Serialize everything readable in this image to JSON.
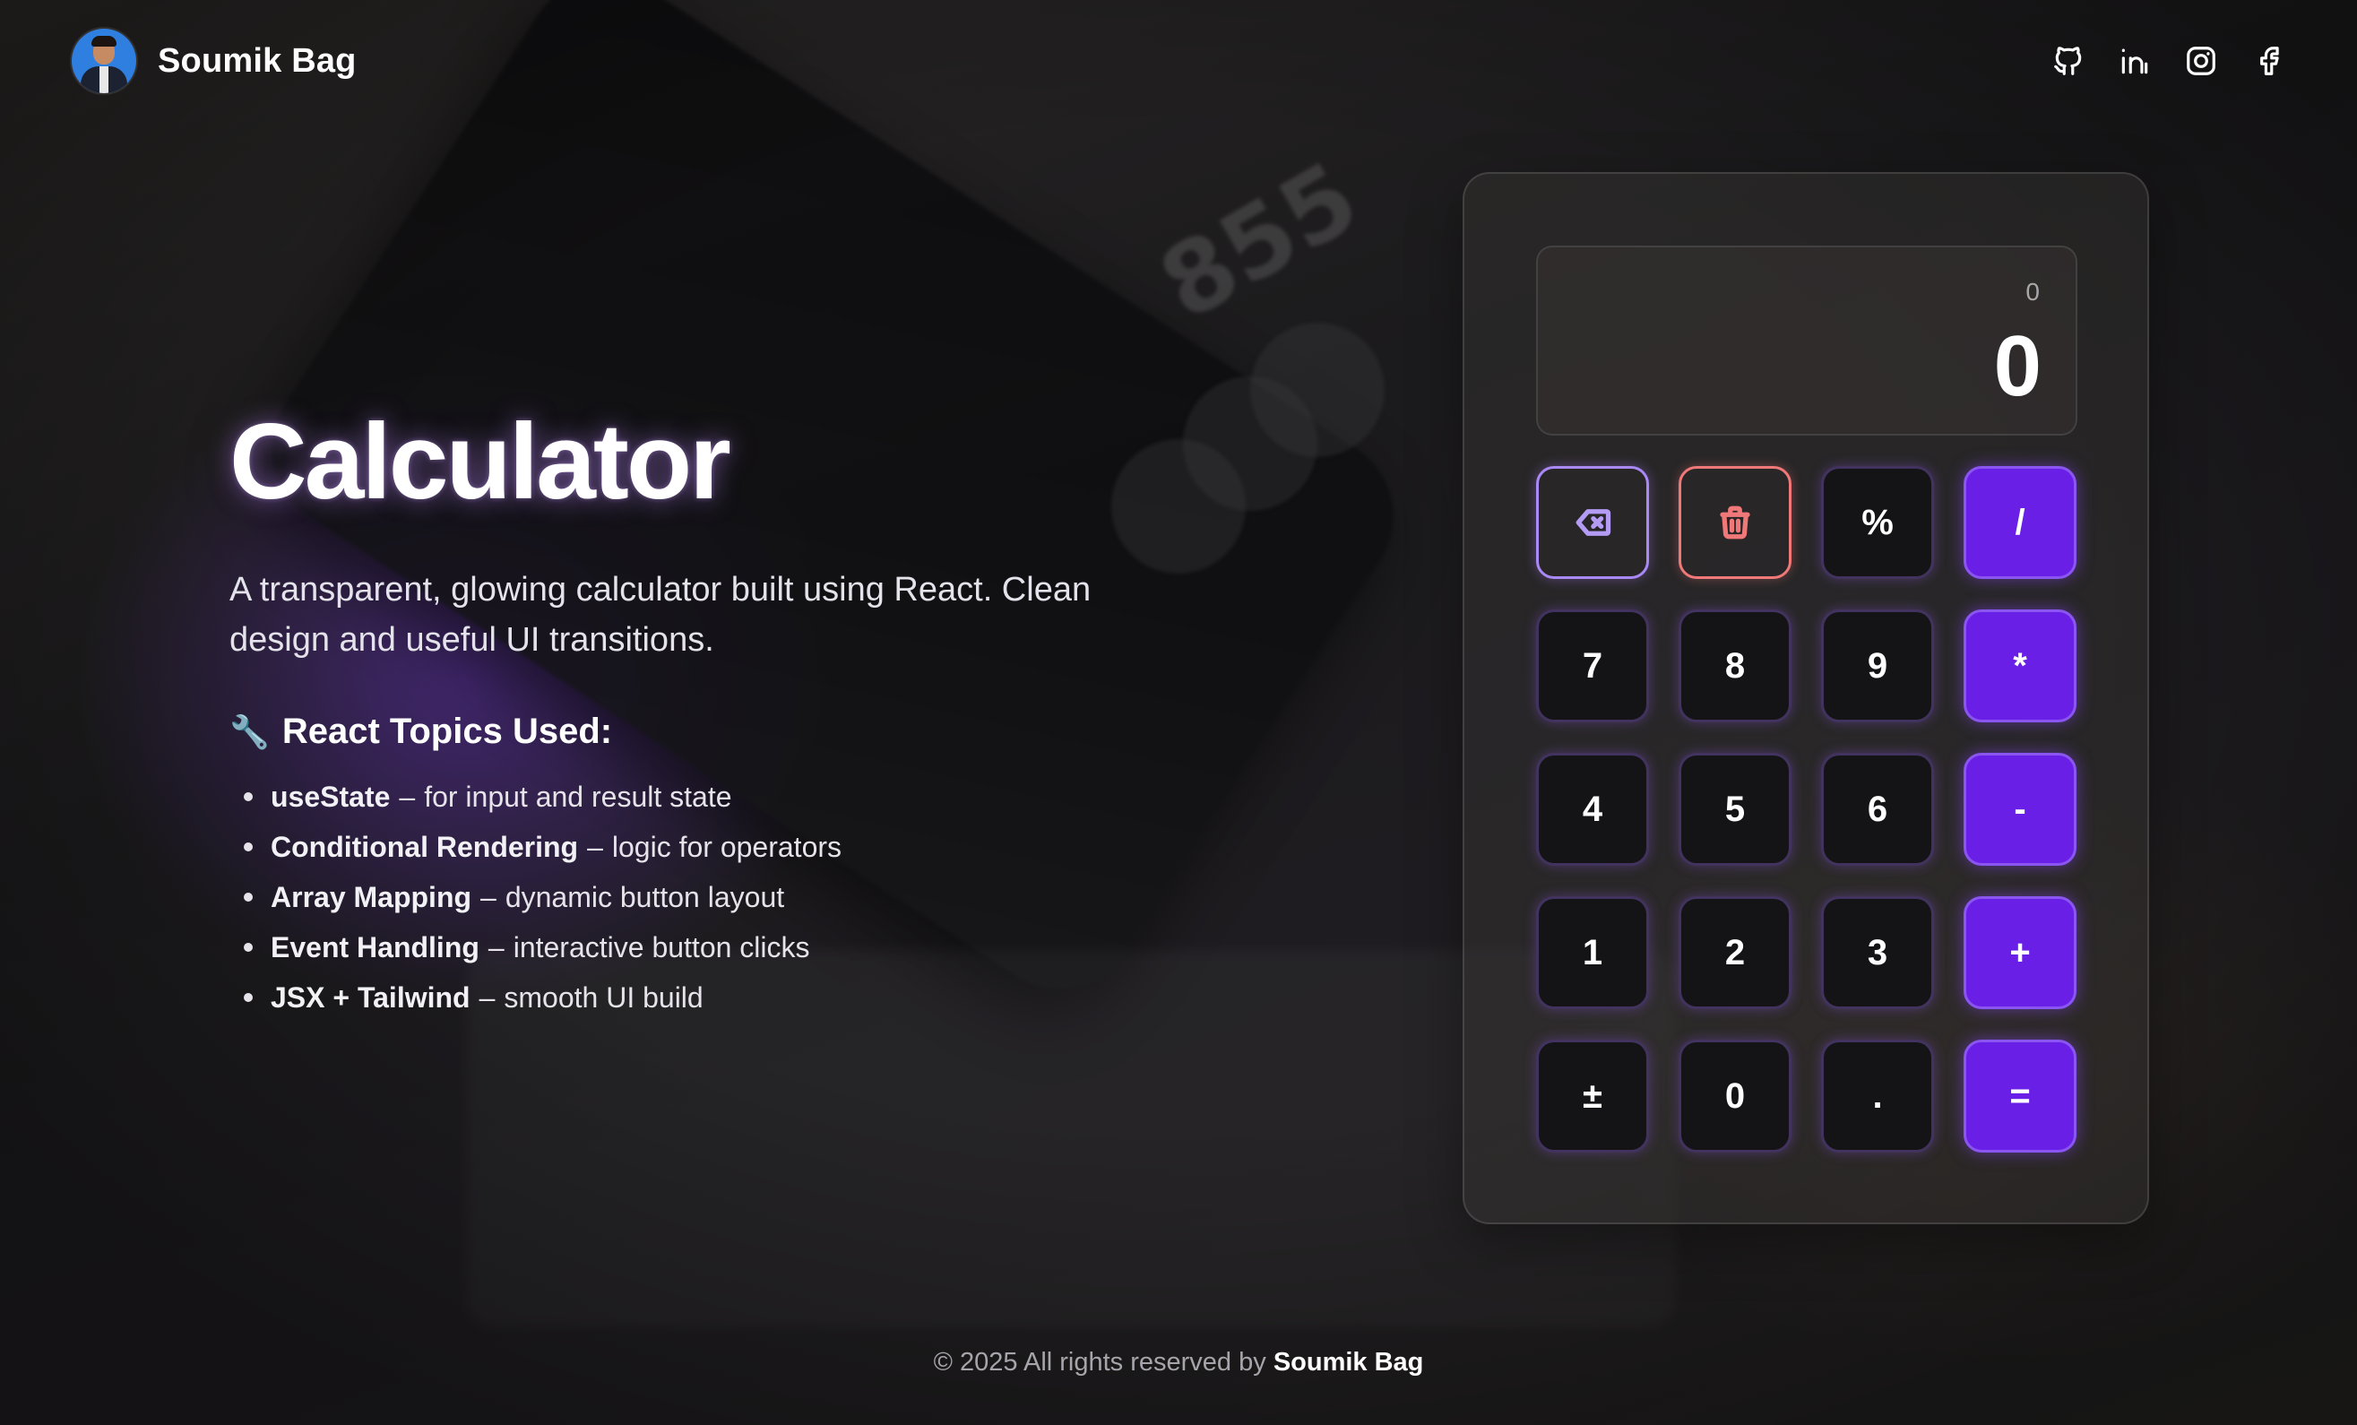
{
  "header": {
    "brand_name": "Soumik Bag",
    "socials": [
      "github-icon",
      "linkedin-icon",
      "instagram-icon",
      "facebook-icon"
    ]
  },
  "info": {
    "title": "Calculator",
    "subtitle": "A transparent, glowing calculator built using React. Clean design and useful UI transitions.",
    "topics_icon": "wrench-icon",
    "topics_heading": "React Topics Used:",
    "topics": [
      {
        "name": "useState",
        "sep": "–",
        "desc": "for input and result state"
      },
      {
        "name": "Conditional Rendering",
        "sep": "–",
        "desc": "logic for operators"
      },
      {
        "name": "Array Mapping",
        "sep": "–",
        "desc": "dynamic button layout"
      },
      {
        "name": "Event Handling",
        "sep": "–",
        "desc": "interactive button clicks"
      },
      {
        "name": "JSX + Tailwind",
        "sep": "–",
        "desc": "smooth UI build"
      }
    ]
  },
  "calculator": {
    "expression": "0",
    "result": "0",
    "keys": {
      "backspace_icon": "backspace-icon",
      "clear_icon": "trash-icon",
      "percent": "%",
      "divide": "/",
      "seven": "7",
      "eight": "8",
      "nine": "9",
      "multiply": "*",
      "four": "4",
      "five": "5",
      "six": "6",
      "subtract": "-",
      "one": "1",
      "two": "2",
      "three": "3",
      "add": "+",
      "plus_minus": "±",
      "zero": "0",
      "decimal": ".",
      "equals": "="
    }
  },
  "background": {
    "phone_digits": "855"
  },
  "footer": {
    "copyright": "© 2025 All rights reserved by",
    "author": "Soumik Bag"
  },
  "colors": {
    "accent": "#6a1fe6",
    "clear": "#f07878",
    "backspace": "#a989f5"
  }
}
